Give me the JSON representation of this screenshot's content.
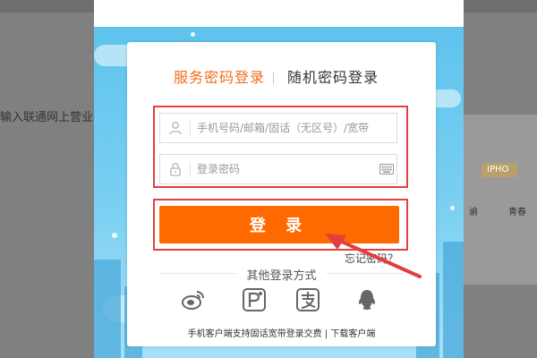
{
  "background": {
    "left_text": "输入联通网上营业",
    "right_badge": "IPHO",
    "right_label1": "谕",
    "right_label2": "青春"
  },
  "login": {
    "tab_service": "服务密码登录",
    "tab_random": "随机密码登录",
    "username_placeholder": "手机号码/邮箱/固话（无区号）/宽带",
    "password_placeholder": "登录密码",
    "login_button": "登 录",
    "forgot_password": "忘记密码？",
    "other_methods_title": "其他登录方式",
    "social": [
      "weibo-icon",
      "alipay-icon",
      "zhifubao-icon",
      "qq-icon"
    ],
    "footer_left": "手机客户端支持固话宽带登录交费",
    "footer_sep": " | ",
    "footer_right": "下载客户端"
  },
  "colors": {
    "accent": "#ff6a00",
    "tab_active": "#f36d1b",
    "highlight_box": "#e0403f",
    "sky": "#5fc3ee"
  }
}
